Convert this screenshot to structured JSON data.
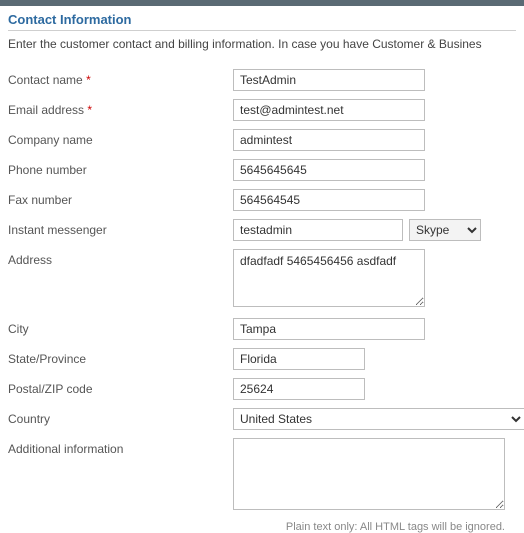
{
  "section": {
    "title": "Contact Information",
    "description": "Enter the customer contact and billing information. In case you have Customer & Busines"
  },
  "labels": {
    "contact_name": "Contact name",
    "email": "Email address",
    "company": "Company name",
    "phone": "Phone number",
    "fax": "Fax number",
    "im": "Instant messenger",
    "address": "Address",
    "city": "City",
    "state": "State/Province",
    "postal": "Postal/ZIP code",
    "country": "Country",
    "additional": "Additional information",
    "required_mark": "*"
  },
  "values": {
    "contact_name": "TestAdmin",
    "email": "test@admintest.net",
    "company": "admintest",
    "phone": "5645645645",
    "fax": "564564545",
    "im_handle": "testadmin",
    "im_service": "Skype",
    "address_pre": "dfadfadf",
    "address_post": " 5465456456 asdfadf",
    "city": "Tampa",
    "state": "Florida",
    "postal": "25624",
    "country": "United States",
    "additional": ""
  },
  "hint": "Plain text only: All HTML tags will be ignored."
}
